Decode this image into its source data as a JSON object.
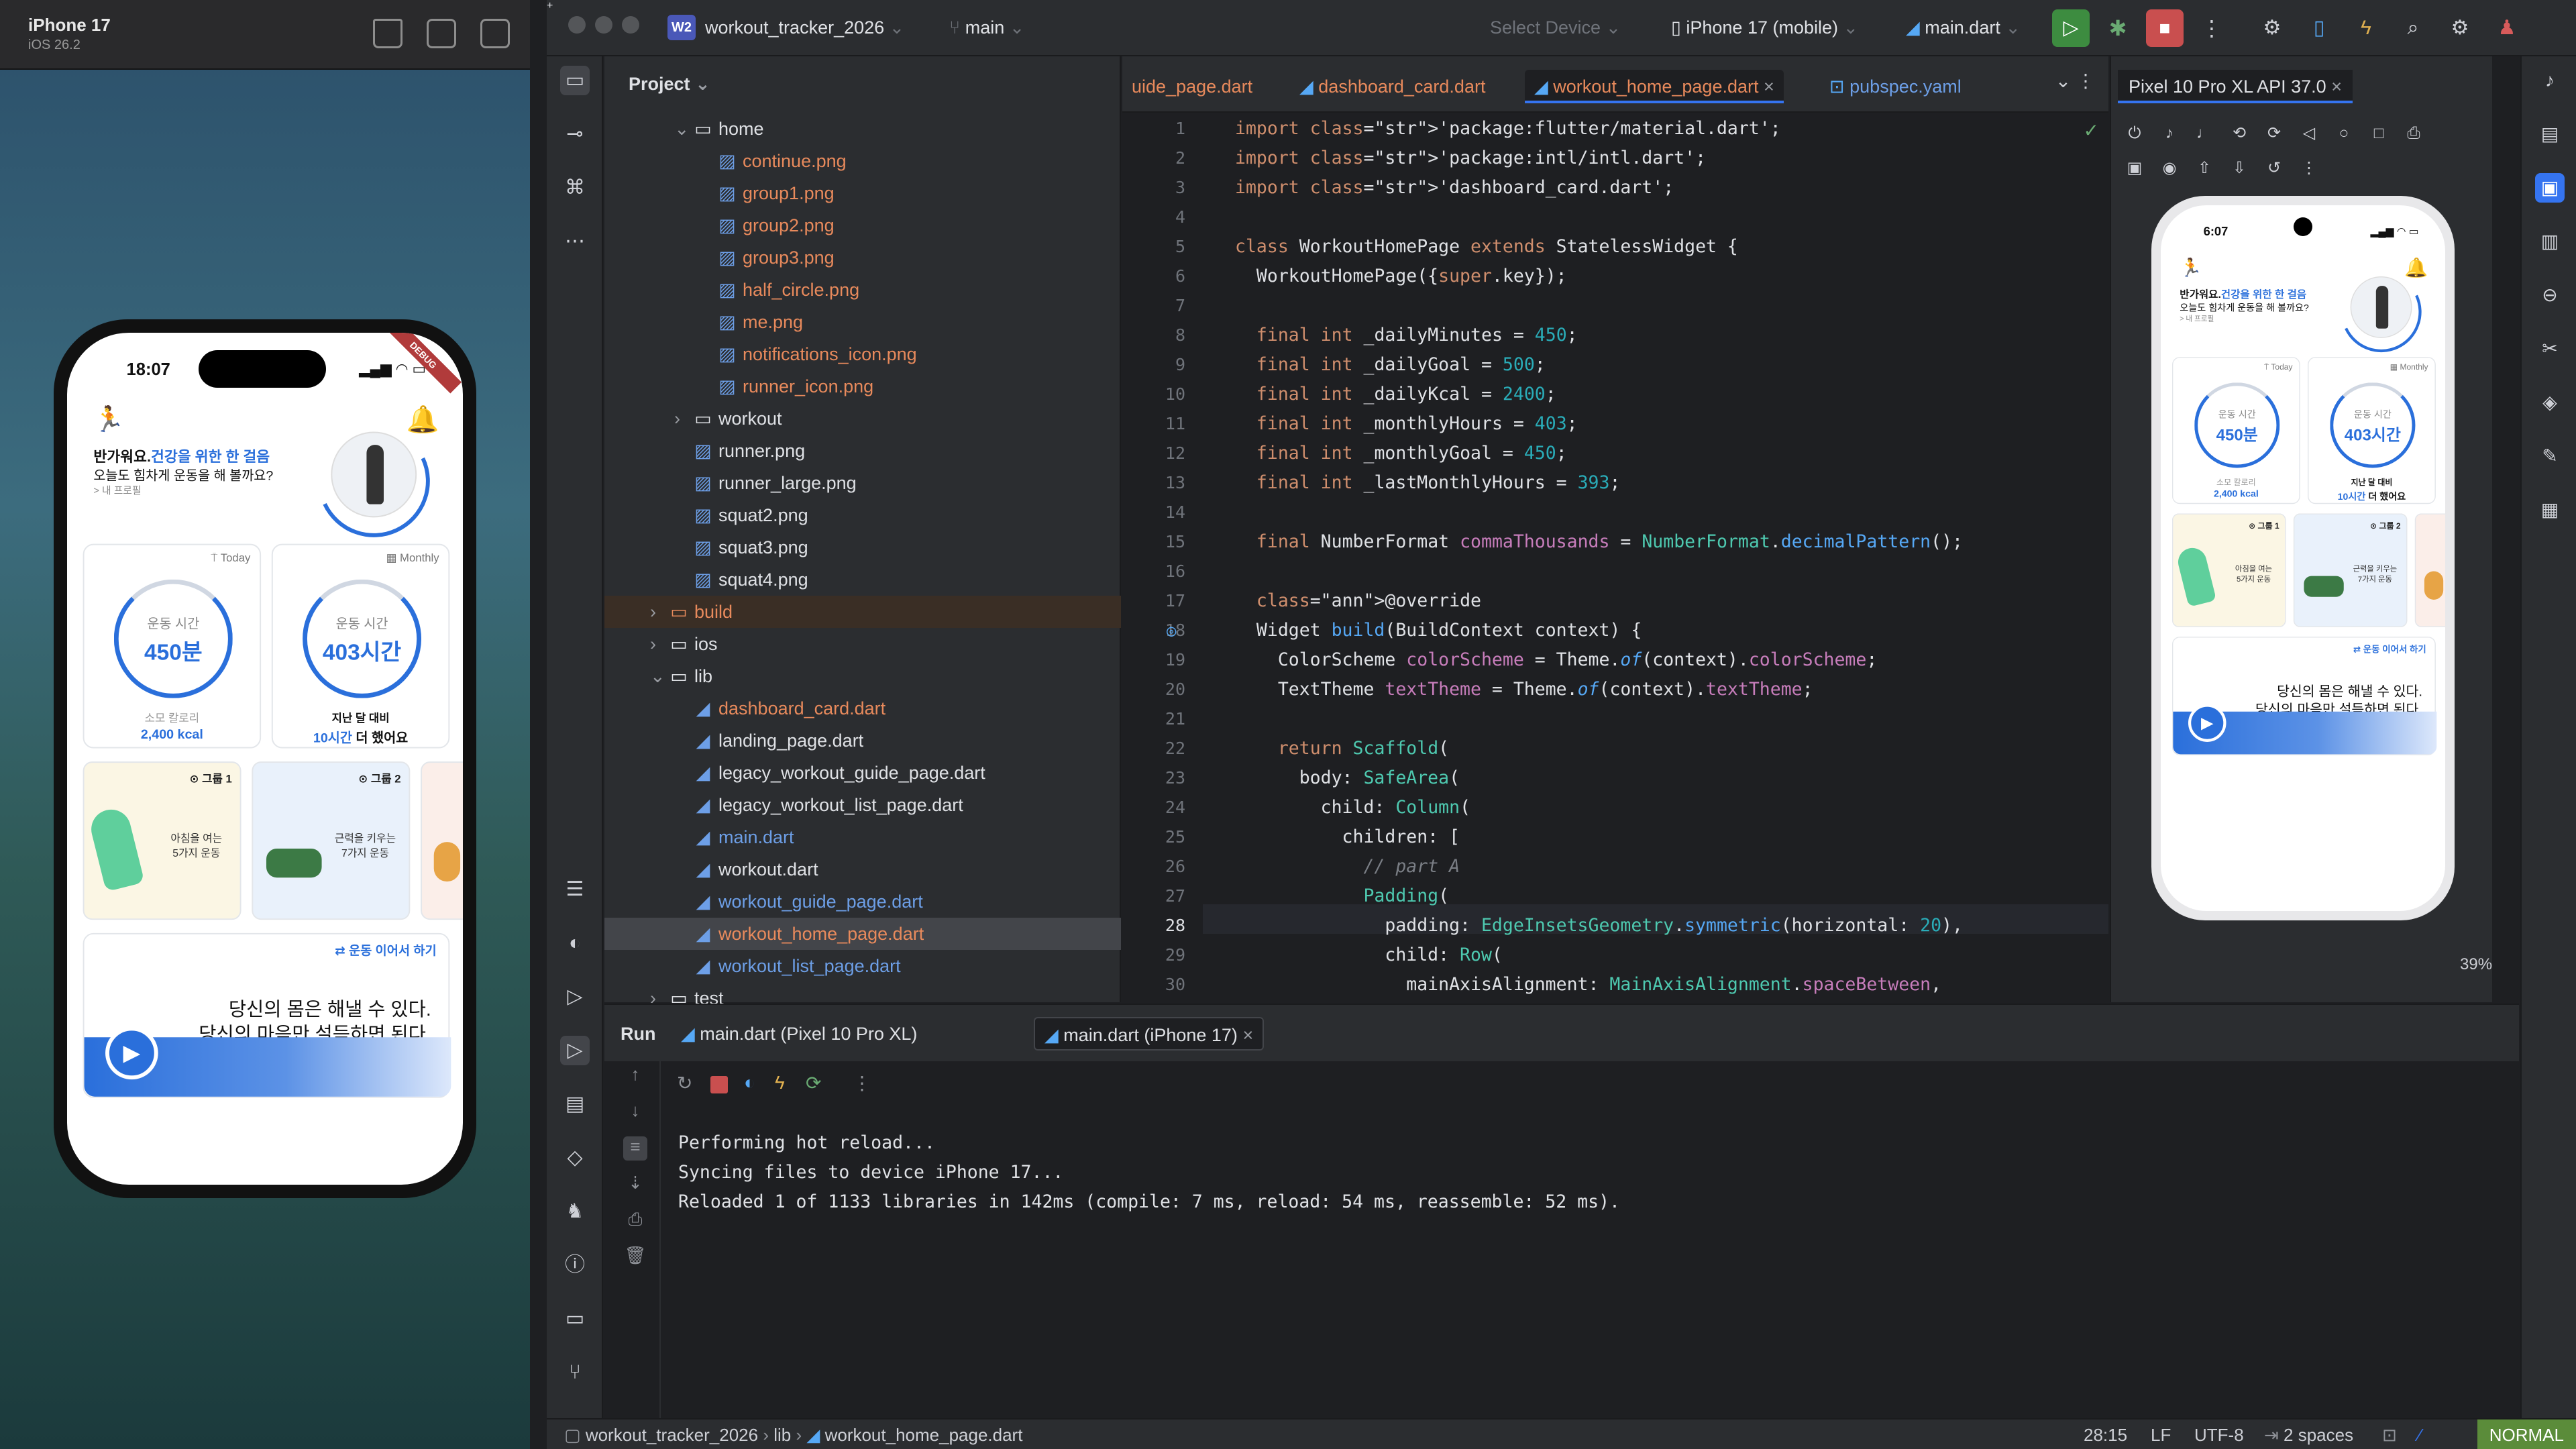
{
  "simulator": {
    "device_name": "iPhone 17",
    "ios_version": "iOS 26.2",
    "icons": [
      "home-icon",
      "screenshot-icon",
      "rotate-icon"
    ]
  },
  "app": {
    "status_time": "18:07",
    "android_time": "6:07",
    "greeting_prefix": "반가워요.",
    "greeting_highlight": "건강을 위한 한 걸음",
    "greeting_line2": "오늘도 힘차게 운동을 해 볼까요?",
    "greeting_link": "> 내 프로필",
    "today_tag": "Today",
    "monthly_tag": "Monthly",
    "today_ring_label": "운동 시간",
    "today_ring_value": "450분",
    "today_stat_label": "소모 칼로리",
    "today_stat_value": "2,400 kcal",
    "monthly_ring_label": "운동 시간",
    "monthly_ring_value": "403시간",
    "monthly_stat_label": "지난 달 대비",
    "monthly_stat_value_blue": "10시간",
    "monthly_stat_value_rest": " 더 했어요",
    "group1_tag": "그룹 1",
    "group1_text": "아침을 여는\n5가지 운동",
    "group2_tag": "그룹 2",
    "group2_text": "근력을 키우는\n7가지 운동",
    "resume_label": "⇄ 운동 이어서 하기",
    "quote_line1": "당신의 몸은 해낼 수 있다.",
    "quote_line2": "당신의 마음만 설득하면 된다.",
    "debug_banner": "DEBUG"
  },
  "ide": {
    "project_badge": "W2",
    "project_name": "workout_tracker_2026",
    "branch": "main",
    "select_device": "Select Device",
    "run_device": "iPhone 17 (mobile)",
    "run_config": "main.dart",
    "project_panel_title": "Project",
    "tree": [
      {
        "label": "home",
        "type": "folder",
        "indent": 2,
        "expanded": true
      },
      {
        "label": "continue.png",
        "type": "png",
        "indent": 3
      },
      {
        "label": "group1.png",
        "type": "png",
        "indent": 3
      },
      {
        "label": "group2.png",
        "type": "png",
        "indent": 3
      },
      {
        "label": "group3.png",
        "type": "png",
        "indent": 3
      },
      {
        "label": "half_circle.png",
        "type": "png",
        "indent": 3
      },
      {
        "label": "me.png",
        "type": "png",
        "indent": 3
      },
      {
        "label": "notifications_icon.png",
        "type": "png",
        "indent": 3
      },
      {
        "label": "runner_icon.png",
        "type": "png",
        "indent": 3
      },
      {
        "label": "workout",
        "type": "folder",
        "indent": 2,
        "expanded": false
      },
      {
        "label": "runner.png",
        "type": "img",
        "indent": 2
      },
      {
        "label": "runner_large.png",
        "type": "img",
        "indent": 2
      },
      {
        "label": "squat2.png",
        "type": "img",
        "indent": 2
      },
      {
        "label": "squat3.png",
        "type": "img",
        "indent": 2
      },
      {
        "label": "squat4.png",
        "type": "img",
        "indent": 2
      },
      {
        "label": "build",
        "type": "build",
        "indent": 1,
        "expanded": false
      },
      {
        "label": "ios",
        "type": "folder",
        "indent": 1,
        "expanded": false
      },
      {
        "label": "lib",
        "type": "folder",
        "indent": 1,
        "expanded": true
      },
      {
        "label": "dashboard_card.dart",
        "type": "dart-mod",
        "indent": 2
      },
      {
        "label": "landing_page.dart",
        "type": "dart",
        "indent": 2
      },
      {
        "label": "legacy_workout_guide_page.dart",
        "type": "dart",
        "indent": 2
      },
      {
        "label": "legacy_workout_list_page.dart",
        "type": "dart",
        "indent": 2
      },
      {
        "label": "main.dart",
        "type": "dart-blue",
        "indent": 2
      },
      {
        "label": "workout.dart",
        "type": "dart",
        "indent": 2
      },
      {
        "label": "workout_guide_page.dart",
        "type": "dart-blue",
        "indent": 2
      },
      {
        "label": "workout_home_page.dart",
        "type": "dart-mod",
        "indent": 2,
        "selected": true
      },
      {
        "label": "workout_list_page.dart",
        "type": "dart-blue",
        "indent": 2
      },
      {
        "label": "test",
        "type": "folder",
        "indent": 1,
        "expanded": false
      }
    ],
    "tabs": [
      {
        "label": "uide_page.dart",
        "color": "orange"
      },
      {
        "label": "dashboard_card.dart",
        "color": "orange"
      },
      {
        "label": "workout_home_page.dart",
        "color": "orange",
        "active": true
      },
      {
        "label": "pubspec.yaml",
        "color": "blue"
      }
    ],
    "current_line": 28,
    "code_lines": [
      "import 'package:flutter/material.dart';",
      "import 'package:intl/intl.dart';",
      "import 'dashboard_card.dart';",
      "",
      "class WorkoutHomePage extends StatelessWidget {",
      "  WorkoutHomePage({super.key});",
      "",
      "  final int _dailyMinutes = 450;",
      "  final int _dailyGoal = 500;",
      "  final int _dailyKcal = 2400;",
      "  final int _monthlyHours = 403;",
      "  final int _monthlyGoal = 450;",
      "  final int _lastMonthlyHours = 393;",
      "",
      "  final NumberFormat commaThousands = NumberFormat.decimalPattern();",
      "",
      "  @override",
      "  Widget build(BuildContext context) {",
      "    ColorScheme colorScheme = Theme.of(context).colorScheme;",
      "    TextTheme textTheme = Theme.of(context).textTheme;",
      "",
      "    return Scaffold(",
      "      body: SafeArea(",
      "        child: Column(",
      "          children: [",
      "            // part A",
      "            Padding(",
      "              padding: EdgeInsetsGeometry.symmetric(horizontal: 20),",
      "              child: Row(",
      "                mainAxisAlignment: MainAxisAlignment.spaceBetween,"
    ],
    "device_tab": "Pixel 10 Pro XL API 37.0",
    "zoom_level": "39%",
    "run_title": "Run",
    "run_tabs": [
      {
        "label": "main.dart (Pixel 10 Pro XL)"
      },
      {
        "label": "main.dart (iPhone 17)",
        "active": true
      }
    ],
    "console": [
      "Performing hot reload...",
      "Syncing files to device iPhone 17...",
      "Reloaded 1 of 1133 libraries in 142ms (compile: 7 ms, reload: 54 ms, reassemble: 52 ms)."
    ],
    "breadcrumb": [
      "workout_tracker_2026",
      "lib",
      "workout_home_page.dart"
    ],
    "cursor_pos": "28:15",
    "line_ending": "LF",
    "encoding": "UTF-8",
    "indent": "2 spaces",
    "vim_mode": "NORMAL"
  },
  "colors": {
    "accent": "#3574f0",
    "app_blue": "#2a6fdb",
    "dart_modified": "#e88a5c",
    "dart_blue": "#6d9fe7"
  }
}
